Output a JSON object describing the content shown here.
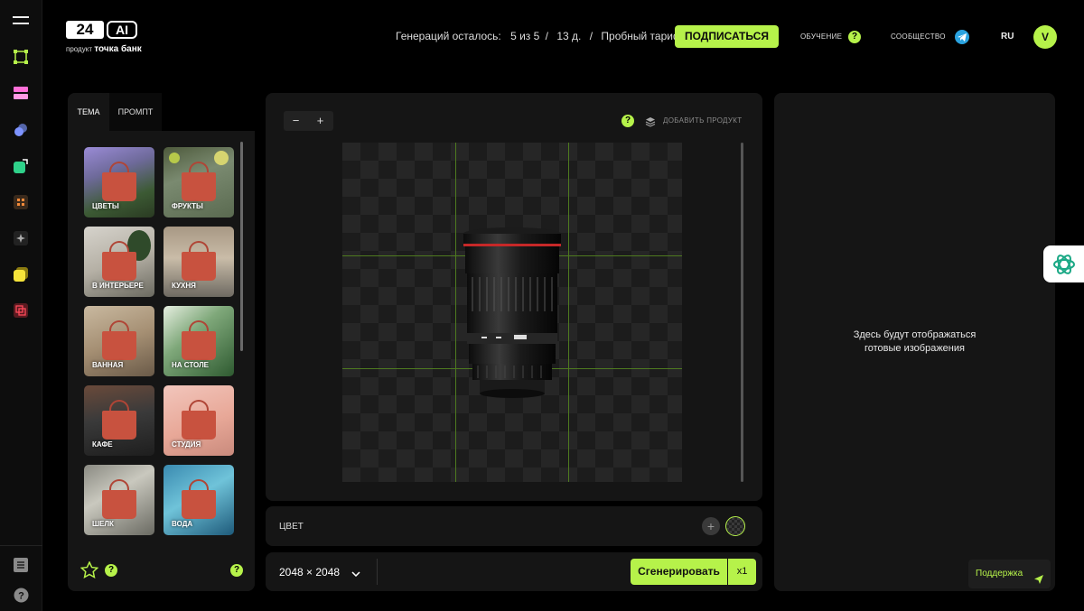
{
  "logo": {
    "num": "24",
    "ai": "AI",
    "sub_prefix": "продукт",
    "sub_brand": "точка банк"
  },
  "header": {
    "gen_label": "Генераций осталось:",
    "gen_count": "5 из 5",
    "sep1": "/",
    "days": "13 д.",
    "sep2": "/",
    "plan": "Пробный тариф",
    "subscribe": "ПОДПИСАТЬСЯ",
    "learning": "ОБУЧЕНИЕ",
    "community": "СООБЩЕСТВО",
    "lang": "RU",
    "avatar": "V",
    "help_mark": "?"
  },
  "left_panel": {
    "tabs": [
      "ТЕМА",
      "ПРОМПТ"
    ],
    "themes": [
      "ЦВЕТЫ",
      "ФРУКТЫ",
      "В ИНТЕРЬЕРЕ",
      "КУХНЯ",
      "ВАННАЯ",
      "НА СТОЛЕ",
      "КАФЕ",
      "СТУДИЯ",
      "ШЕЛК",
      "ВОДА"
    ],
    "help_mark": "?"
  },
  "canvas": {
    "zoom_out": "−",
    "zoom_in": "+",
    "add_product": "ДОБАВИТЬ ПРОДУКТ",
    "help_mark": "?"
  },
  "color": {
    "label": "ЦВЕТ"
  },
  "controls": {
    "size": "2048 × 2048",
    "generate": "Сгенерировать",
    "count": "x1"
  },
  "results": {
    "placeholder_line1": "Здесь будут отображаться",
    "placeholder_line2": "готовые изображения"
  },
  "support": {
    "label": "Поддержка"
  },
  "colors": {
    "accent": "#b6f24a",
    "panel": "#151515",
    "bg": "#000000",
    "telegram": "#2aa3e0"
  }
}
